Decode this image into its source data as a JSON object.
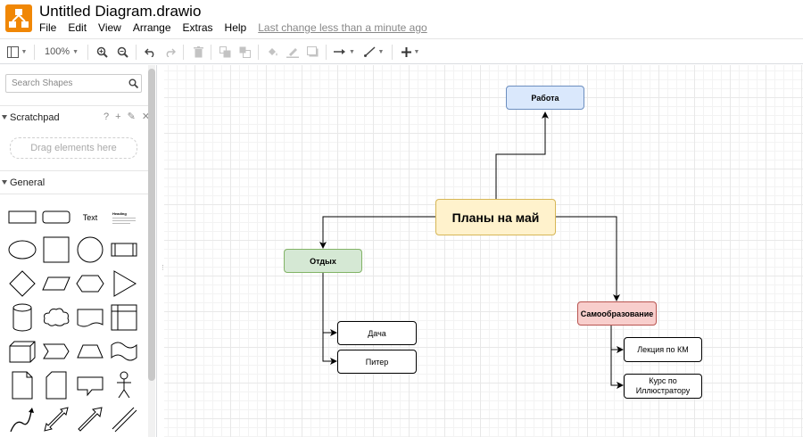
{
  "app": {
    "title": "Untitled Diagram.drawio",
    "brand_color": "#f08705"
  },
  "menu": {
    "items": [
      "File",
      "Edit",
      "View",
      "Arrange",
      "Extras",
      "Help"
    ],
    "last_change": "Last change less than a minute ago"
  },
  "toolbar": {
    "zoom": "100%"
  },
  "sidebar": {
    "search_placeholder": "Search Shapes",
    "scratchpad_title": "Scratchpad",
    "scratchpad_icons": "? + ✎ ✕",
    "drop_hint": "Drag elements here",
    "general_title": "General",
    "text_shape_label": "Text",
    "heading_shape_label": "Heading"
  },
  "diagram": {
    "root": "Планы на май",
    "work": "Работа",
    "rest": "Отдых",
    "rest_child_1": "Дача",
    "rest_child_2": "Питер",
    "self": "Самообразование",
    "self_child_1": "Лекция по КМ",
    "self_child_2": "Курс по Иллюстратору",
    "colors": {
      "root_fill": "#fff2cc",
      "root_stroke": "#d6b656",
      "work_fill": "#dae8fc",
      "work_stroke": "#6c8ebf",
      "rest_fill": "#d5e8d4",
      "rest_stroke": "#82b366",
      "self_fill": "#f8cecc",
      "self_stroke": "#b85450"
    }
  }
}
